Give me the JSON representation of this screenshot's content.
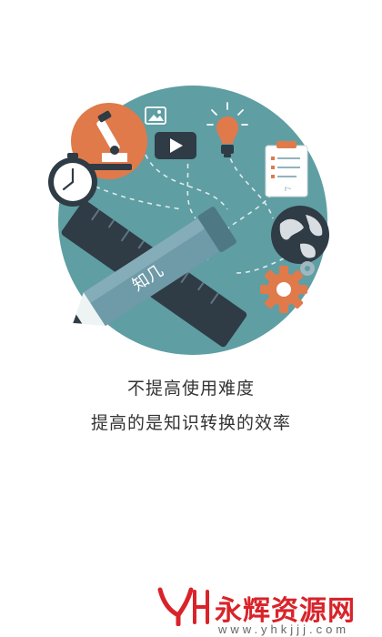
{
  "intro": {
    "tagline_1": "不提高使用难度",
    "tagline_2": "提高的是知识转换的效率",
    "pencil_brand": "知几",
    "clipboard_mark": "r~"
  },
  "watermark": {
    "brand_text": "永辉资源网",
    "url_text": "www.yhkjjj.com"
  },
  "colors": {
    "circle": "#5f9ea3",
    "orange": "#e07a4a",
    "dark": "#2f3b45",
    "accent_red": "#d9232a"
  },
  "icons": [
    "microscope-icon",
    "image-icon",
    "video-play-icon",
    "lightbulb-icon",
    "clock-icon",
    "checklist-clipboard-icon",
    "globe-icon",
    "gear-icon",
    "ruler-icon",
    "pencil-icon",
    "question-mark-icon"
  ]
}
